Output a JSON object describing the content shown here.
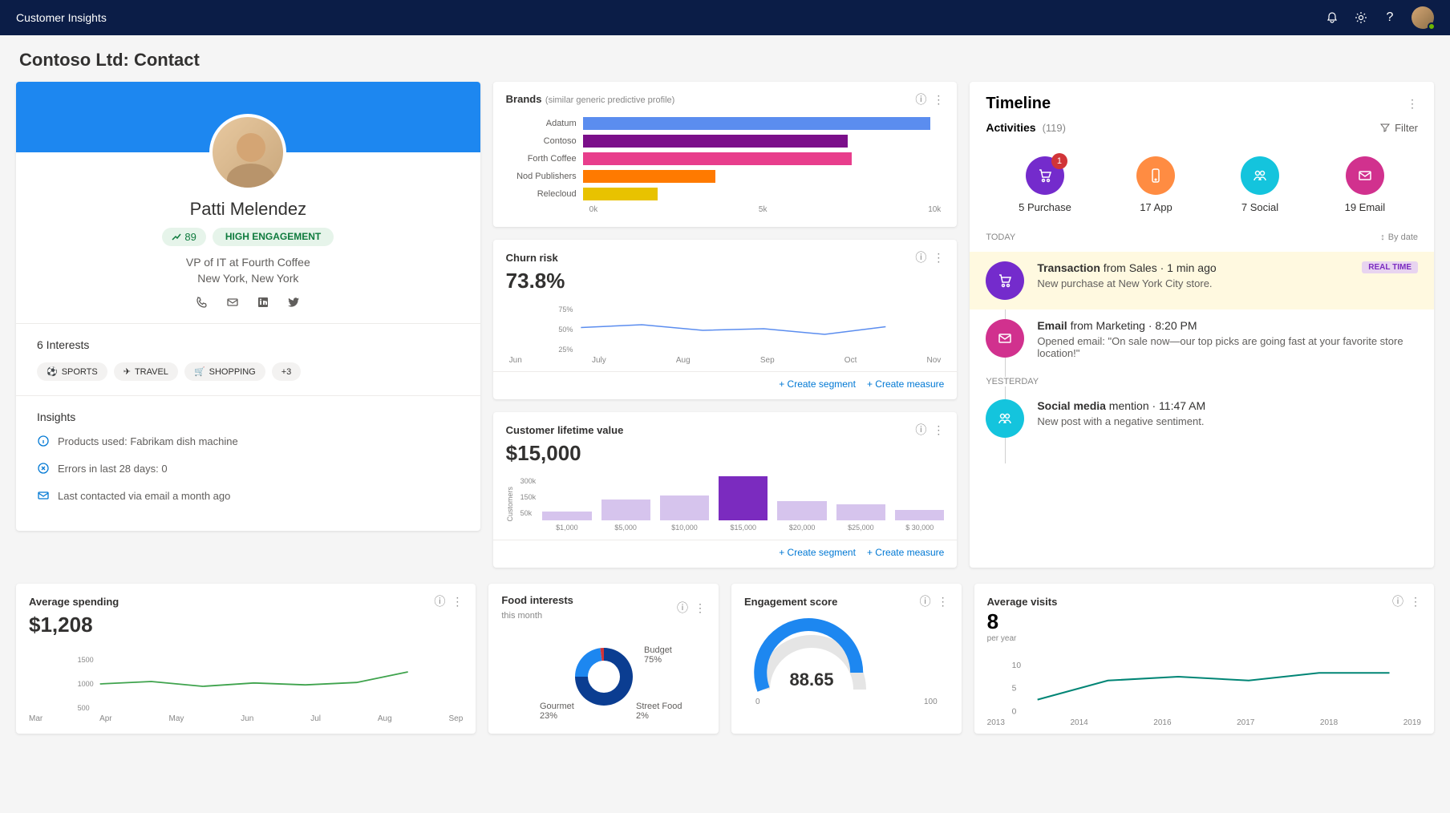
{
  "app": {
    "title": "Customer Insights"
  },
  "page": {
    "heading": "Contoso Ltd: Contact"
  },
  "profile": {
    "name": "Patti Melendez",
    "score": "89",
    "engagement": "HIGH ENGAGEMENT",
    "job_title": "VP of IT at Fourth Coffee",
    "location": "New York, New York",
    "interests_heading": "6 Interests",
    "interests": [
      "SPORTS",
      "TRAVEL",
      "SHOPPING"
    ],
    "interests_more": "+3",
    "insights_heading": "Insights",
    "insights": [
      "Products used: Fabrikam dish machine",
      "Errors in last 28 days: 0",
      "Last contacted via email a month ago"
    ]
  },
  "brands": {
    "title": "Brands",
    "subtitle": "(similar generic predictive profile)",
    "axis": [
      "0k",
      "5k",
      "10k"
    ]
  },
  "chart_data": [
    {
      "id": "brands",
      "type": "bar",
      "orientation": "horizontal",
      "categories": [
        "Adatum",
        "Contoso",
        "Forth Coffee",
        "Nod Publishers",
        "Relecloud"
      ],
      "values": [
        9700,
        7400,
        7500,
        3700,
        2100
      ],
      "colors": [
        "#5b8def",
        "#7b0f8a",
        "#e83e8c",
        "#ff7a00",
        "#e8c200"
      ],
      "xlim": [
        0,
        10000
      ]
    },
    {
      "id": "churn",
      "type": "line",
      "title": "Churn risk",
      "headline": "73.8%",
      "categories": [
        "Jun",
        "July",
        "Aug",
        "Sep",
        "Oct",
        "Nov"
      ],
      "values": [
        55,
        62,
        48,
        52,
        38,
        57
      ],
      "yticks": [
        "25%",
        "50%",
        "75%"
      ],
      "ylim": [
        0,
        100
      ]
    },
    {
      "id": "clv",
      "type": "bar",
      "title": "Customer lifetime value",
      "headline": "$15,000",
      "ylabel": "Customers",
      "categories": [
        "$1,000",
        "$5,000",
        "$10,000",
        "$15,000",
        "$20,000",
        "$25,000",
        "$ 30,000"
      ],
      "values": [
        60,
        140,
        170,
        300,
        130,
        110,
        70
      ],
      "highlight_index": 3,
      "yticks": [
        "50k",
        "150k",
        "300k"
      ]
    },
    {
      "id": "spending",
      "type": "line",
      "title": "Average spending",
      "headline": "$1,208",
      "categories": [
        "Mar",
        "Apr",
        "May",
        "Jun",
        "Jul",
        "Aug",
        "Sep"
      ],
      "values": [
        1000,
        1050,
        950,
        1020,
        980,
        1030,
        1250
      ],
      "yticks": [
        "500",
        "1000",
        "1500"
      ],
      "color": "#3fa34d"
    },
    {
      "id": "food",
      "type": "pie",
      "title": "Food interests",
      "subtitle": "this month",
      "series": [
        {
          "name": "Budget",
          "value": 75,
          "label": "75%",
          "color": "#0b3d91"
        },
        {
          "name": "Gourmet",
          "value": 23,
          "label": "23%",
          "color": "#1d87f0"
        },
        {
          "name": "Street Food",
          "value": 2,
          "label": "2%",
          "color": "#d13438"
        }
      ]
    },
    {
      "id": "engagement",
      "type": "gauge",
      "title": "Engagement score",
      "value": 88.65,
      "display": "88.65",
      "min": 0,
      "max": 100,
      "mid": 50,
      "color": "#1d87f0"
    },
    {
      "id": "visits",
      "type": "line",
      "title": "Average visits",
      "headline": "8",
      "sub": "per year",
      "categories": [
        "2013",
        "2014",
        "2016",
        "2017",
        "2018",
        "2019"
      ],
      "values": [
        3,
        8,
        9,
        8,
        10,
        10
      ],
      "yticks": [
        "0",
        "5",
        "10"
      ],
      "color": "#008575"
    }
  ],
  "links": {
    "create_segment": "Create segment",
    "create_measure": "Create measure"
  },
  "timeline": {
    "title": "Timeline",
    "activities_label": "Activities",
    "activities_count": "(119)",
    "filter": "Filter",
    "sort": "By date",
    "today": "TODAY",
    "yesterday": "YESTERDAY",
    "icons": [
      {
        "count": 5,
        "label": "5 Purchase",
        "badge": "1",
        "color": "purple",
        "glyph": "cart"
      },
      {
        "count": 17,
        "label": "17 App",
        "color": "orange",
        "glyph": "phone"
      },
      {
        "count": 7,
        "label": "7 Social",
        "color": "teal",
        "glyph": "people"
      },
      {
        "count": 19,
        "label": "19 Email",
        "color": "magenta",
        "glyph": "mail"
      }
    ],
    "items": [
      {
        "kind": "Transaction",
        "meta": " from Sales · 1 min ago",
        "body": "New purchase at New York City store.",
        "realtime": "REAL TIME",
        "highlight": true,
        "color": "purple",
        "glyph": "cart"
      },
      {
        "kind": "Email",
        "meta": " from Marketing · 8:20 PM",
        "body": "Opened email: \"On sale now—our top picks are going fast at your favorite store location!\"",
        "color": "magenta",
        "glyph": "mail"
      },
      {
        "kind": "Social media",
        "meta": " mention · 11:47 AM",
        "body": "New post with a negative sentiment.",
        "color": "teal",
        "glyph": "people",
        "day_before": "YESTERDAY"
      }
    ]
  }
}
